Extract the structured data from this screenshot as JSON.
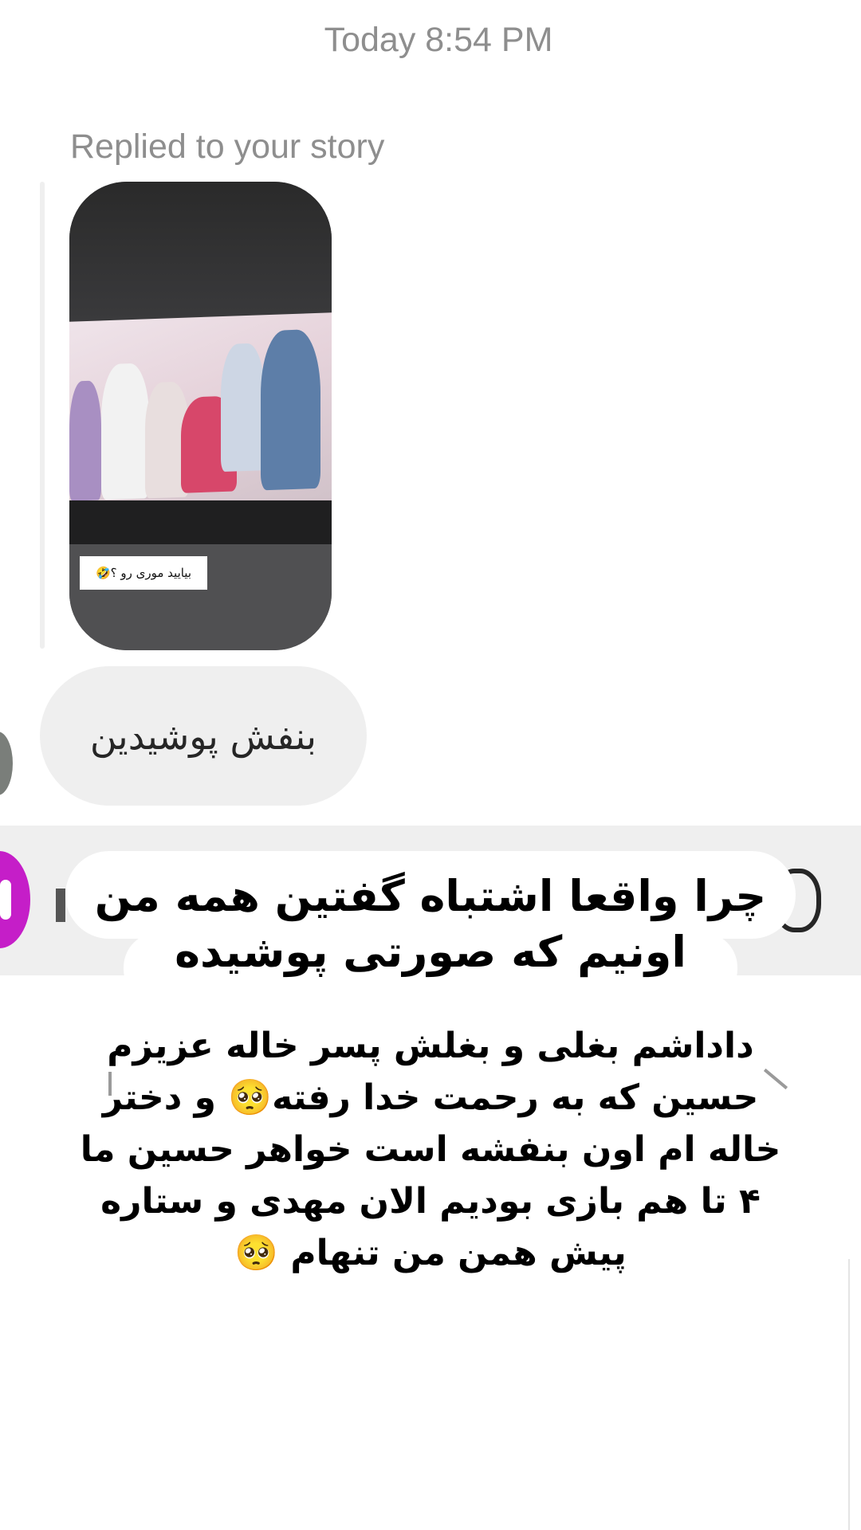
{
  "timestamp": "Today 8:54 PM",
  "reply_label": "Replied to your story",
  "story_caption": "بیایید موری رو ؟🤣",
  "message_text": "بنفش پوشیدین",
  "overlay_text": "چرا واقعا اشتباه گفتین همه من اونیم که صورتی پوشیده",
  "story_text": "داداشم بغلی و بغلش پسر خاله عزیزم حسین  که به رحمت خدا رفته🥺 و دختر خاله ام اون بنفشه است  خواهر حسین ما ۴ تا هم بازی بودیم الان مهدی و ستاره پیش همن من تنهام 🥺",
  "colors": {
    "camera_button": "#c51ec8",
    "bubble": "#efefef",
    "muted_text": "#8e8e8e"
  },
  "icons": [
    "camera-icon",
    "sticker-icon"
  ]
}
